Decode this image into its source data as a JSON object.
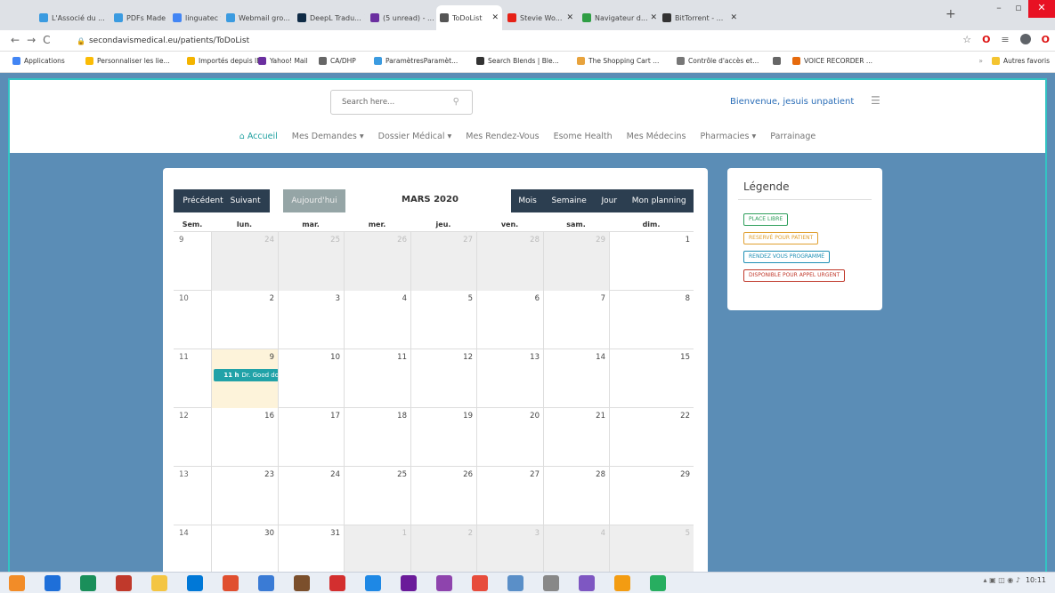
{
  "browser": {
    "tabs": [
      {
        "label": "L'Associé du ...",
        "color": "#3b9be0"
      },
      {
        "label": "PDFs Made S...",
        "color": "#3b9be0"
      },
      {
        "label": "linguatec fre...",
        "color": "#4285f4"
      },
      {
        "label": "Webmail gro...",
        "color": "#3b9be0"
      },
      {
        "label": "DeepL Tradu...",
        "color": "#0f2b46"
      },
      {
        "label": "(5 unread) - ...",
        "color": "#6b2fa0"
      },
      {
        "label": "ToDoList",
        "color": "#555555"
      },
      {
        "label": "Stevie Wo...",
        "color": "#e62117"
      },
      {
        "label": "Navigateur d...",
        "color": "#2f9e44"
      },
      {
        "label": "BitTorrent - ...",
        "color": "#333333"
      }
    ],
    "url": "secondavismedical.eu/patients/ToDoList",
    "bookmarks": [
      {
        "label": "Applications",
        "color": "#4285f4"
      },
      {
        "label": "Personnaliser les lie...",
        "color": "#fbbc05"
      },
      {
        "label": "Importés depuis IE",
        "color": "#f4b400"
      },
      {
        "label": "Yahoo! Mail",
        "color": "#6b2fa0"
      },
      {
        "label": "CA/DHP",
        "color": "#666666"
      },
      {
        "label": "ParamètresParamèt...",
        "color": "#3b9be0"
      },
      {
        "label": "Search Blends | Ble...",
        "color": "#333333"
      },
      {
        "label": "The Shopping Cart ...",
        "color": "#e8a33d"
      },
      {
        "label": "Contrôle d'accès et...",
        "color": "#777777"
      },
      {
        "label": "",
        "color": "#666666"
      },
      {
        "label": "VOICE RECORDER ...",
        "color": "#e66a0c"
      }
    ],
    "other_bookmarks": "Autres favoris"
  },
  "header": {
    "search_placeholder": "Search here...",
    "welcome": "Bienvenue, jesuis unpatient",
    "nav": [
      "Accueil",
      "Mes Demandes ▾",
      "Dossier Médical ▾",
      "Mes Rendez-Vous",
      "Esome Health",
      "Mes Médecins",
      "Pharmacies ▾",
      "Parrainage"
    ]
  },
  "calendar": {
    "prev": "Précédent",
    "next": "Suivant",
    "today": "Aujourd'hui",
    "title": "MARS 2020",
    "views": [
      "Mois",
      "Semaine",
      "Jour",
      "Mon planning"
    ],
    "headers": [
      "Sem.",
      "lun.",
      "mar.",
      "mer.",
      "jeu.",
      "ven.",
      "sam.",
      "dim."
    ],
    "weeks": [
      {
        "num": "9",
        "days": [
          "24",
          "25",
          "26",
          "27",
          "28",
          "29",
          "1"
        ],
        "other": [
          1,
          1,
          1,
          1,
          1,
          1,
          0
        ]
      },
      {
        "num": "10",
        "days": [
          "2",
          "3",
          "4",
          "5",
          "6",
          "7",
          "8"
        ],
        "other": [
          0,
          0,
          0,
          0,
          0,
          0,
          0
        ]
      },
      {
        "num": "11",
        "days": [
          "9",
          "10",
          "11",
          "12",
          "13",
          "14",
          "15"
        ],
        "other": [
          0,
          0,
          0,
          0,
          0,
          0,
          0
        ]
      },
      {
        "num": "12",
        "days": [
          "16",
          "17",
          "18",
          "19",
          "20",
          "21",
          "22"
        ],
        "other": [
          0,
          0,
          0,
          0,
          0,
          0,
          0
        ]
      },
      {
        "num": "13",
        "days": [
          "23",
          "24",
          "25",
          "26",
          "27",
          "28",
          "29"
        ],
        "other": [
          0,
          0,
          0,
          0,
          0,
          0,
          0
        ]
      },
      {
        "num": "14",
        "days": [
          "30",
          "31",
          "1",
          "2",
          "3",
          "4",
          "5"
        ],
        "other": [
          0,
          0,
          1,
          1,
          1,
          1,
          1
        ]
      }
    ],
    "event": {
      "time": "11 h",
      "label": "Dr. Good do"
    }
  },
  "legend": {
    "title": "Légende",
    "items": [
      {
        "label": "PLACE LIBRE",
        "color": "#2e9e5b"
      },
      {
        "label": "RESERVÉ POUR PATIENT",
        "color": "#e0a030"
      },
      {
        "label": "RENDEZ VOUS PROGRAMMÉ",
        "color": "#1f8fb5"
      },
      {
        "label": "DISPONIBLE POUR APPEL URGENT",
        "color": "#c0392b"
      }
    ]
  },
  "taskbar": {
    "time": "10:11"
  }
}
